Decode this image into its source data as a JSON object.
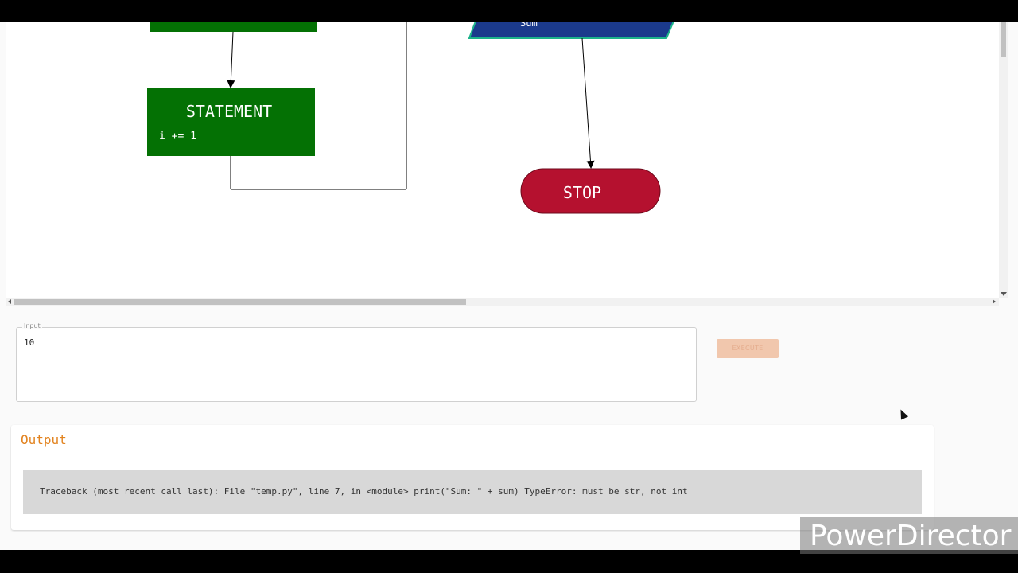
{
  "flowchart": {
    "statement_node": {
      "title": "STATEMENT",
      "code": "i += 1"
    },
    "output_node": {
      "text": "Sum"
    },
    "stop_node": {
      "label": "STOP"
    }
  },
  "input": {
    "legend": "Input",
    "value": "10"
  },
  "execute_button": {
    "label": "EXECUTE"
  },
  "output": {
    "title": "Output",
    "text": "Traceback (most recent call last): File \"temp.py\", line 7, in <module> print(\"Sum: \" + sum) TypeError: must be str, not int"
  },
  "watermark": {
    "text": "PowerDirector"
  },
  "colors": {
    "statement_green": "#047104",
    "stop_red": "#b5112f",
    "io_blue": "#1b3a8c",
    "accent_orange": "#e2831f"
  }
}
